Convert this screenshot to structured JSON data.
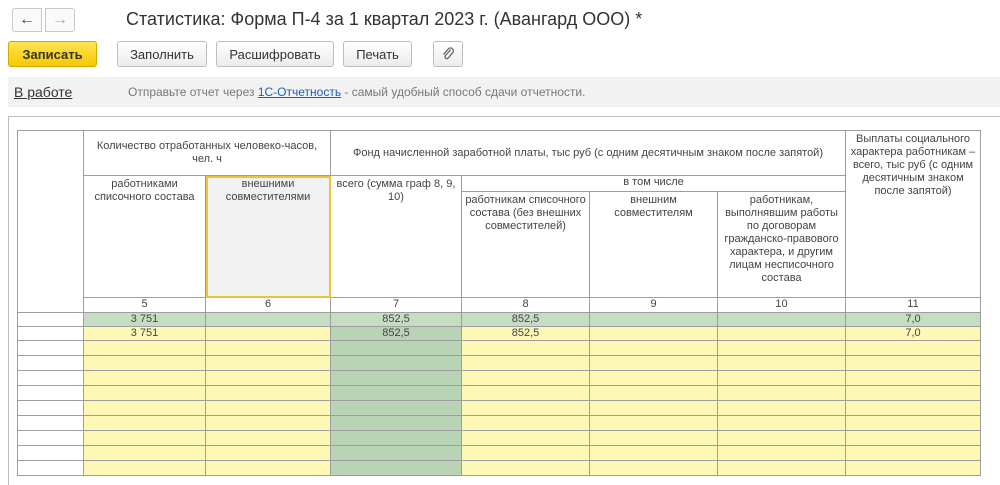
{
  "window": {
    "title": "Статистика: Форма П-4 за 1 квартал 2023 г. (Авангард ООО) *",
    "back_glyph": "←",
    "forward_glyph": "→"
  },
  "toolbar": {
    "save_label": "Записать",
    "fill_label": "Заполнить",
    "decode_label": "Расшифровать",
    "print_label": "Печать",
    "attach_glyph": "📎"
  },
  "infobar": {
    "status": "В работе",
    "text_before": "Отправьте отчет через ",
    "link": "1С-Отчетность",
    "text_after": " - самый удобный способ сдачи отчетности."
  },
  "table": {
    "group_hours": "Количество отработанных человеко-часов, чел. ч",
    "group_fund": "Фонд начисленной заработной платы, тыс руб (с одним десятичным знаком после запятой)",
    "col_social": "Выплаты социального характера работникам – всего, тыс руб (с одним десятичным знаком после запятой)",
    "col_staff": "работниками списочного состава",
    "col_external": "внешними совместителями",
    "col_total": "всего (сумма граф 8, 9, 10)",
    "including": "в том числе",
    "col_fund_staff": "работникам списочного состава (без внешних совместителей)",
    "col_fund_external": "внешним совместителям",
    "col_fund_contract": "работникам, выполнявшим работы по договорам гражданско-правового характера, и другим лицам несписочного состава",
    "col_numbers": [
      "5",
      "6",
      "7",
      "8",
      "9",
      "10",
      "11"
    ],
    "rows": [
      [
        "3 751",
        "",
        "852,5",
        "852,5",
        "",
        "",
        "7,0"
      ],
      [
        "3 751",
        "",
        "852,5",
        "852,5",
        "",
        "",
        "7,0"
      ]
    ]
  },
  "colors": {
    "primary_button": "#f5c800",
    "row_green": "#c6ddc3",
    "row_yellow": "#fdf8b6",
    "link": "#1b5fb0"
  }
}
